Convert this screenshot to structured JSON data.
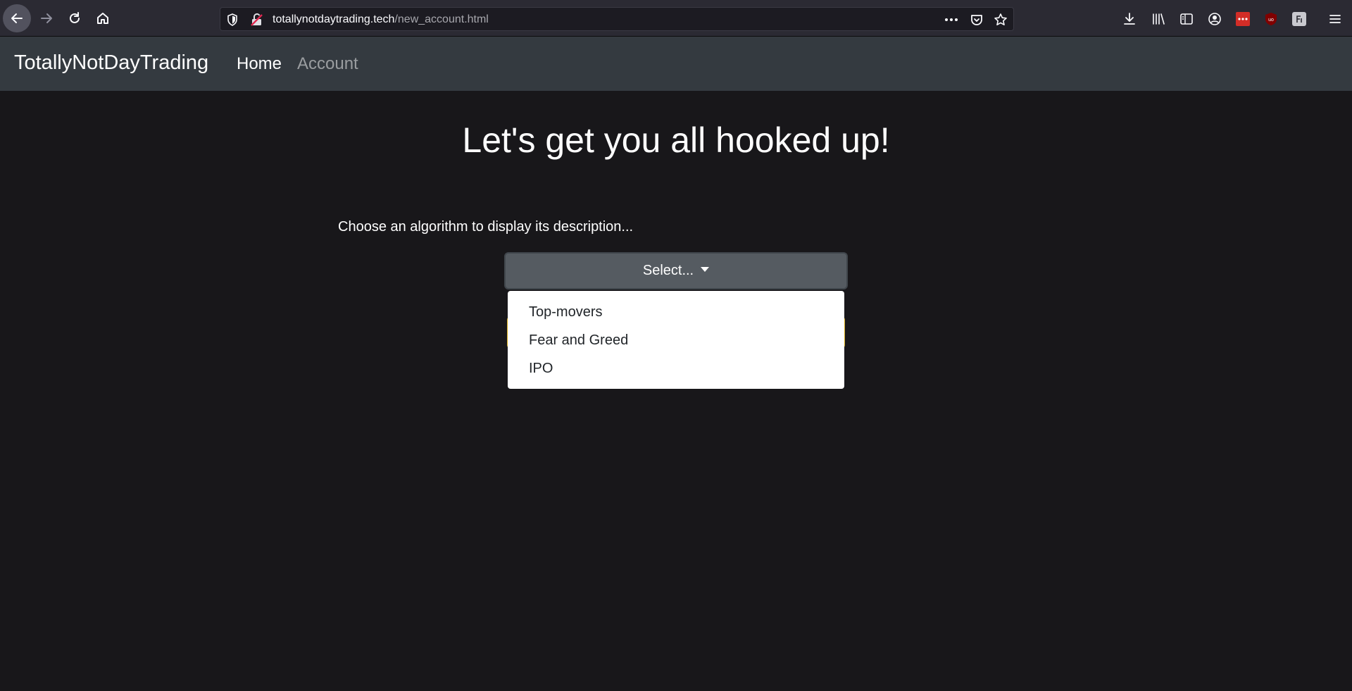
{
  "browser": {
    "url_domain": "totallynotdaytrading.tech",
    "url_path": "/new_account.html",
    "icons": [
      "back-icon",
      "forward-icon",
      "reload-icon",
      "home-icon",
      "shield-icon",
      "lock-icon",
      "more-icon",
      "pocket-icon",
      "star-icon",
      "download-icon",
      "library-icon",
      "sidebar-icon",
      "account-icon",
      "lastpass-icon",
      "ublock-icon",
      "extension-icon",
      "menu-icon"
    ]
  },
  "navbar": {
    "brand": "TotallyNotDayTrading",
    "links": [
      {
        "label": "Home",
        "active": true
      },
      {
        "label": "Account",
        "active": false
      }
    ]
  },
  "main": {
    "title": "Let's get you all hooked up!",
    "instruction": "Choose an algorithm to display its description...",
    "select_label": "Select...",
    "dropdown_options": [
      "Top-movers",
      "Fear and Greed",
      "IPO"
    ]
  },
  "colors": {
    "page_background": "#18171a",
    "navbar_background": "#343a40",
    "select_background": "#555b61",
    "inactive_link": "#9a9da0",
    "highlight_border": "#d4a91a"
  }
}
